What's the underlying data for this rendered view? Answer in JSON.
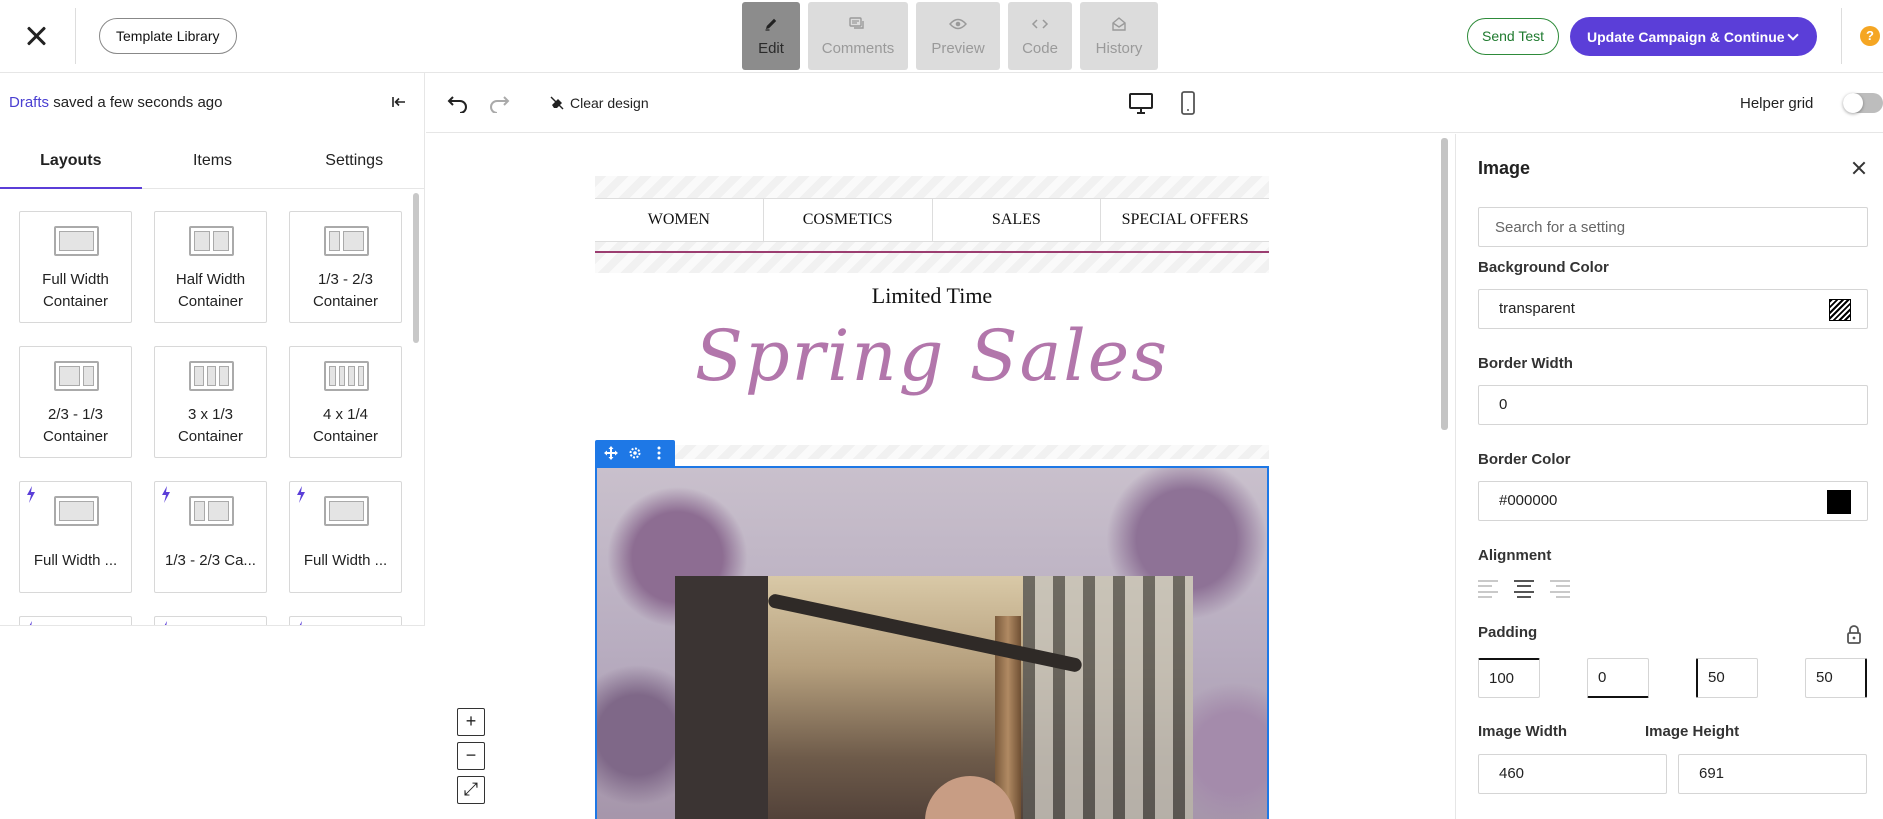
{
  "topbar": {
    "template_library": "Template Library",
    "modes": [
      {
        "label": "Edit",
        "icon": "pencil-icon",
        "active": true
      },
      {
        "label": "Comments",
        "icon": "comments-icon",
        "active": false
      },
      {
        "label": "Preview",
        "icon": "eye-icon",
        "active": false
      },
      {
        "label": "Code",
        "icon": "code-icon",
        "active": false
      },
      {
        "label": "History",
        "icon": "history-icon",
        "active": false
      }
    ],
    "send_test": "Send Test",
    "update_button": "Update Campaign & Continue",
    "help": "?"
  },
  "left_panel": {
    "drafts_link": "Drafts",
    "drafts_status": "saved a few seconds ago",
    "tabs": [
      "Layouts",
      "Items",
      "Settings"
    ],
    "active_tab": "Layouts",
    "tiles": [
      {
        "label": "Full Width Container",
        "icon": "full-width-icon",
        "premium": false
      },
      {
        "label": "Half Width Container",
        "icon": "half-width-icon",
        "premium": false
      },
      {
        "label": "1/3 - 2/3 Container",
        "icon": "third-two-thirds-icon",
        "premium": false
      },
      {
        "label": "2/3 - 1/3 Container",
        "icon": "two-thirds-third-icon",
        "premium": false
      },
      {
        "label": "3 x 1/3 Container",
        "icon": "three-columns-icon",
        "premium": false
      },
      {
        "label": "4 x 1/4 Container",
        "icon": "four-columns-icon",
        "premium": false
      },
      {
        "label": "Full Width ...",
        "icon": "cart-layout-icon",
        "premium": true
      },
      {
        "label": "1/3 - 2/3 Ca...",
        "icon": "card-layout-icon",
        "premium": true
      },
      {
        "label": "Full Width ...",
        "icon": "tag-layout-icon",
        "premium": true
      }
    ]
  },
  "canvas_toolbar": {
    "clear_design": "Clear design",
    "helper_grid": "Helper grid",
    "helper_grid_on": false
  },
  "email": {
    "nav": [
      "WOMEN",
      "COSMETICS",
      "SALES",
      "SPECIAL OFFERS"
    ],
    "limited_time": "Limited Time",
    "headline": "Spring Sales"
  },
  "zoom": [
    "+",
    "−",
    "⤢"
  ],
  "right_panel": {
    "title": "Image",
    "search_placeholder": "Search for a setting",
    "background_color_label": "Background Color",
    "background_color_value": "transparent",
    "border_width_label": "Border Width",
    "border_width_value": "0",
    "border_color_label": "Border Color",
    "border_color_value": "#000000",
    "alignment_label": "Alignment",
    "alignment_selected": "center",
    "padding_label": "Padding",
    "padding": [
      "100",
      "0",
      "50",
      "50"
    ],
    "image_width_label": "Image Width",
    "image_width_value": "460",
    "image_height_label": "Image Height",
    "image_height_value": "691"
  },
  "colors": {
    "accent": "#5b3ed8",
    "selection": "#1e78e6",
    "headline": "#b276ab",
    "nav_rule": "#9b3d70",
    "send_test": "#2e8b3a",
    "help": "#f5a623"
  }
}
